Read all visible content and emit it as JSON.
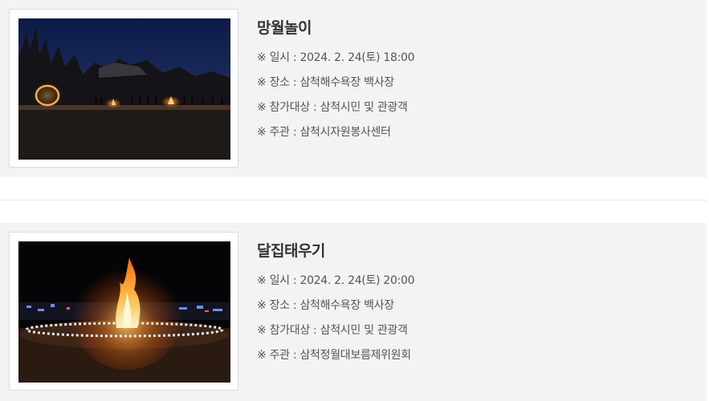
{
  "events": [
    {
      "title": "망월놀이",
      "photo_icon": "bonfire-night-photo",
      "details": [
        "※ 일시 : 2024. 2. 24(토) 18:00",
        "※ 장소 : 삼척해수욕장 백사장",
        "※ 참가대상 : 삼척시민 및 관광객",
        "※ 주관 : 삼척시자원봉사센터"
      ]
    },
    {
      "title": "달집태우기",
      "photo_icon": "moon-house-burning-photo",
      "details": [
        "※ 일시 : 2024. 2. 24(토) 20:00",
        "※ 장소 : 삼척해수욕장 백사장",
        "※ 참가대상 : 삼척시민 및 관광객",
        "※ 주관 : 삼척정월대보름제위원회"
      ]
    }
  ],
  "colors": {
    "card_background": "#f3f3f3",
    "title_text": "#333333",
    "detail_text": "#555555",
    "frame_border": "#dcdcdc"
  }
}
